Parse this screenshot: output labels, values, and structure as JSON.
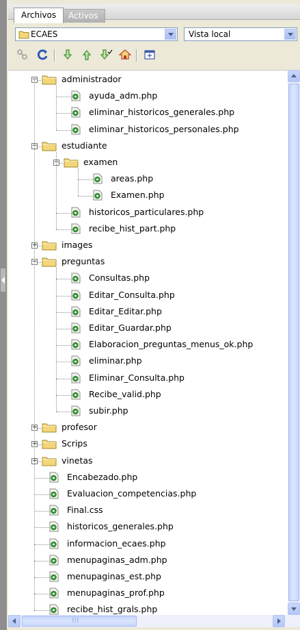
{
  "tabs": [
    {
      "label": "Archivos",
      "active": true
    },
    {
      "label": "Activos",
      "active": false
    }
  ],
  "site_select": {
    "value": "ECAES"
  },
  "view_select": {
    "value": "Vista local"
  },
  "toolbar": {
    "icons": [
      "connect-icon",
      "refresh-icon",
      "get-file-icon",
      "put-file-icon",
      "check-out-icon",
      "check-in-icon",
      "expand-icon"
    ]
  },
  "tree": [
    {
      "label": "administrador",
      "type": "folder",
      "depth": 0,
      "expanded": true
    },
    {
      "label": "ayuda_adm.php",
      "type": "file",
      "depth": 1
    },
    {
      "label": "eliminar_historicos_generales.php",
      "type": "file",
      "depth": 1
    },
    {
      "label": "eliminar_historicos_personales.php",
      "type": "file",
      "depth": 1
    },
    {
      "label": "estudiante",
      "type": "folder",
      "depth": 0,
      "expanded": true
    },
    {
      "label": "examen",
      "type": "folder",
      "depth": 1,
      "expanded": true
    },
    {
      "label": "areas.php",
      "type": "file",
      "depth": 2
    },
    {
      "label": "Examen.php",
      "type": "file",
      "depth": 2
    },
    {
      "label": "historicos_particulares.php",
      "type": "file",
      "depth": 1
    },
    {
      "label": "recibe_hist_part.php",
      "type": "file",
      "depth": 1
    },
    {
      "label": "images",
      "type": "folder",
      "depth": 0,
      "expanded": false
    },
    {
      "label": "preguntas",
      "type": "folder",
      "depth": 0,
      "expanded": true
    },
    {
      "label": "Consultas.php",
      "type": "file",
      "depth": 1
    },
    {
      "label": "Editar_Consulta.php",
      "type": "file",
      "depth": 1
    },
    {
      "label": "Editar_Editar.php",
      "type": "file",
      "depth": 1
    },
    {
      "label": "Editar_Guardar.php",
      "type": "file",
      "depth": 1
    },
    {
      "label": "Elaboracion_preguntas_menus_ok.php",
      "type": "file",
      "depth": 1
    },
    {
      "label": "eliminar.php",
      "type": "file",
      "depth": 1
    },
    {
      "label": "Eliminar_Consulta.php",
      "type": "file",
      "depth": 1
    },
    {
      "label": "Recibe_valid.php",
      "type": "file",
      "depth": 1
    },
    {
      "label": "subir.php",
      "type": "file",
      "depth": 1
    },
    {
      "label": "profesor",
      "type": "folder",
      "depth": 0,
      "expanded": false
    },
    {
      "label": "Scrips",
      "type": "folder",
      "depth": 0,
      "expanded": false
    },
    {
      "label": "vinetas",
      "type": "folder",
      "depth": 0,
      "expanded": false
    },
    {
      "label": "Encabezado.php",
      "type": "file",
      "depth": 0
    },
    {
      "label": "Evaluacion_competencias.php",
      "type": "file",
      "depth": 0
    },
    {
      "label": "Final.css",
      "type": "file",
      "depth": 0
    },
    {
      "label": "historicos_generales.php",
      "type": "file",
      "depth": 0
    },
    {
      "label": "informacion_ecaes.php",
      "type": "file",
      "depth": 0
    },
    {
      "label": "menupaginas_adm.php",
      "type": "file",
      "depth": 0
    },
    {
      "label": "menupaginas_est.php",
      "type": "file",
      "depth": 0
    },
    {
      "label": "menupaginas_prof.php",
      "type": "file",
      "depth": 0
    },
    {
      "label": "recibe_hist_grals.php",
      "type": "file",
      "depth": 0
    }
  ],
  "colors": {
    "folder": "#f4d67a",
    "folder_stroke": "#a08a2e",
    "file_green": "#2f8f2f",
    "accent": "#316ac5"
  }
}
